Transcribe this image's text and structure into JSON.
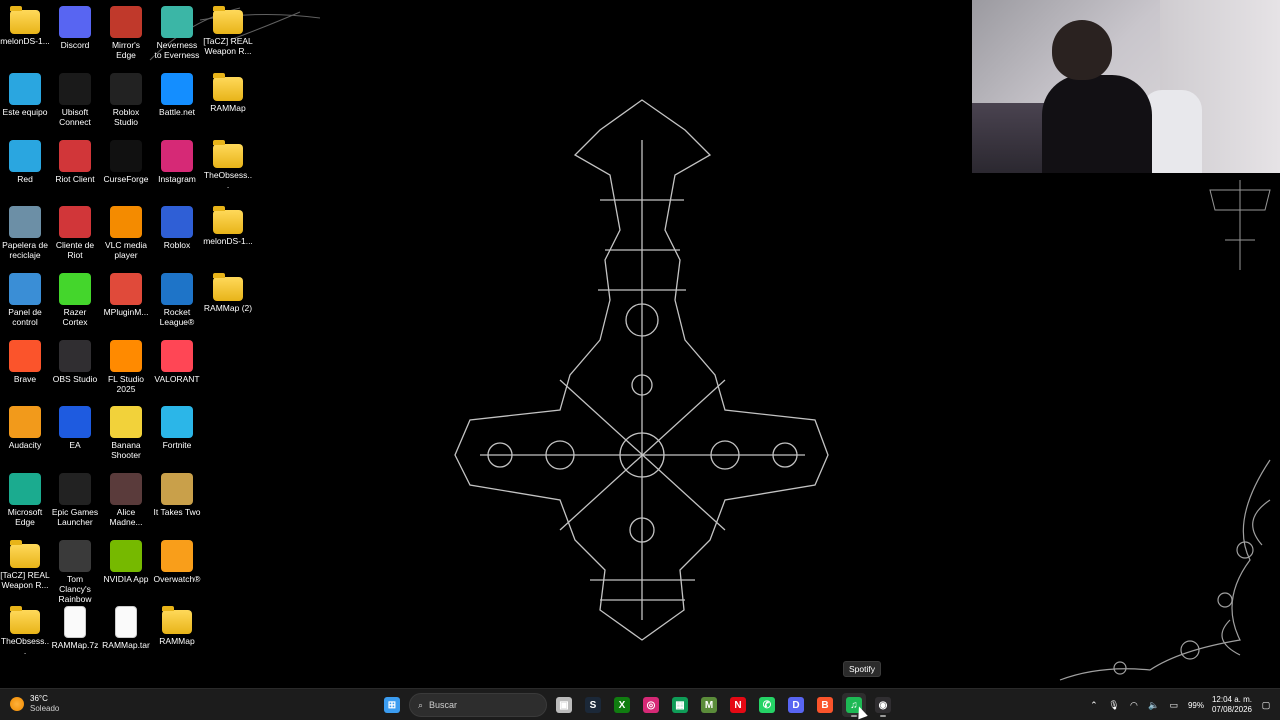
{
  "desktop": {
    "icons": [
      {
        "label": "melonDS-1...",
        "icon": "folder-icon",
        "color": "#f2c230"
      },
      {
        "label": "Discord",
        "icon": "discord-icon",
        "color": "#5865f2"
      },
      {
        "label": "Mirror's Edge",
        "icon": "mirrors-edge-icon",
        "color": "#c0392b"
      },
      {
        "label": "Neverness to Everness",
        "icon": "neverness-icon",
        "color": "#3bb6a6"
      },
      {
        "label": "[TaCZ] REAL Weapon R...",
        "icon": "folder-icon",
        "color": "#f2c230"
      },
      {
        "label": "Este equipo",
        "icon": "this-pc-icon",
        "color": "#2aa6e0"
      },
      {
        "label": "Ubisoft Connect",
        "icon": "ubisoft-icon",
        "color": "#1a1a1a"
      },
      {
        "label": "Roblox Studio",
        "icon": "roblox-studio-icon",
        "color": "#222"
      },
      {
        "label": "Battle.net",
        "icon": "battlenet-icon",
        "color": "#148eff"
      },
      {
        "label": "RAMMap",
        "icon": "folder-icon",
        "color": "#f2c230"
      },
      {
        "label": "Red",
        "icon": "network-icon",
        "color": "#2aa6e0"
      },
      {
        "label": "Riot Client",
        "icon": "riot-icon",
        "color": "#d13639"
      },
      {
        "label": "CurseForge",
        "icon": "curseforge-icon",
        "color": "#111"
      },
      {
        "label": "Instagram",
        "icon": "instagram-icon",
        "color": "#d62976"
      },
      {
        "label": "TheObsess...",
        "icon": "folder-icon",
        "color": "#f2c230"
      },
      {
        "label": "Papelera de reciclaje",
        "icon": "recycle-bin-icon",
        "color": "#6c8fa6"
      },
      {
        "label": "Cliente de Riot",
        "icon": "riot-icon",
        "color": "#d13639"
      },
      {
        "label": "VLC media player",
        "icon": "vlc-icon",
        "color": "#f48b00"
      },
      {
        "label": "Roblox",
        "icon": "roblox-icon",
        "color": "#2f5fd6"
      },
      {
        "label": "melonDS-1...",
        "icon": "folder-icon",
        "color": "#f2c230"
      },
      {
        "label": "Panel de control",
        "icon": "control-panel-icon",
        "color": "#3a8ed6"
      },
      {
        "label": "Razer Cortex",
        "icon": "razer-cortex-icon",
        "color": "#44d62c"
      },
      {
        "label": "MPluginM...",
        "icon": "mplugin-icon",
        "color": "#e04a3a"
      },
      {
        "label": "Rocket League®",
        "icon": "rocket-league-icon",
        "color": "#1e74c8"
      },
      {
        "label": "RAMMap (2)",
        "icon": "folder-icon",
        "color": "#f2c230"
      },
      {
        "label": "Brave",
        "icon": "brave-icon",
        "color": "#fb542b"
      },
      {
        "label": "OBS Studio",
        "icon": "obs-icon",
        "color": "#302e31"
      },
      {
        "label": "FL Studio 2025",
        "icon": "fl-studio-icon",
        "color": "#ff8a00"
      },
      {
        "label": "VALORANT",
        "icon": "valorant-icon",
        "color": "#ff4655"
      },
      {
        "label": "",
        "icon": "",
        "color": ""
      },
      {
        "label": "Audacity",
        "icon": "audacity-icon",
        "color": "#f29a1b"
      },
      {
        "label": "EA",
        "icon": "ea-icon",
        "color": "#1e5be0"
      },
      {
        "label": "Banana Shooter",
        "icon": "banana-shooter-icon",
        "color": "#f2d23a"
      },
      {
        "label": "Fortnite",
        "icon": "fortnite-icon",
        "color": "#2bb6e8"
      },
      {
        "label": "",
        "icon": "",
        "color": ""
      },
      {
        "label": "Microsoft Edge",
        "icon": "edge-icon",
        "color": "#1bab8f"
      },
      {
        "label": "Epic Games Launcher",
        "icon": "epic-games-icon",
        "color": "#222"
      },
      {
        "label": "Alice Madne...",
        "icon": "alice-madness-icon",
        "color": "#5a3b3b"
      },
      {
        "label": "It Takes Two",
        "icon": "it-takes-two-icon",
        "color": "#c9a04a"
      },
      {
        "label": "",
        "icon": "",
        "color": ""
      },
      {
        "label": "[TaCZ] REAL Weapon R...",
        "icon": "folder-icon",
        "color": "#f2c230"
      },
      {
        "label": "Tom Clancy's Rainbow Si...",
        "icon": "rainbow-six-icon",
        "color": "#3a3a3a"
      },
      {
        "label": "NVIDIA App",
        "icon": "nvidia-icon",
        "color": "#76b900"
      },
      {
        "label": "Overwatch®",
        "icon": "overwatch-icon",
        "color": "#f99e1a"
      },
      {
        "label": "",
        "icon": "",
        "color": ""
      },
      {
        "label": "TheObsess...",
        "icon": "folder-icon",
        "color": "#f2c230"
      },
      {
        "label": "RAMMap.7z",
        "icon": "file-icon",
        "color": "#fafafa"
      },
      {
        "label": "RAMMap.tar",
        "icon": "file-icon",
        "color": "#fafafa"
      },
      {
        "label": "RAMMap",
        "icon": "folder-icon",
        "color": "#f2c230"
      },
      {
        "label": "",
        "icon": "",
        "color": ""
      }
    ]
  },
  "tooltip": {
    "text": "Spotify"
  },
  "taskbar": {
    "weather": {
      "temp": "36°C",
      "condition": "Soleado"
    },
    "search_placeholder": "Buscar",
    "apps": [
      {
        "name": "start-button",
        "glyph": "⊞",
        "color": "#3b9cf0"
      },
      {
        "name": "task-view-button",
        "glyph": "▣",
        "color": "#bbbbbb"
      },
      {
        "name": "steam-button",
        "glyph": "S",
        "color": "#1b2838"
      },
      {
        "name": "xbox-button",
        "glyph": "X",
        "color": "#107c10"
      },
      {
        "name": "instagram-button",
        "glyph": "◎",
        "color": "#d62976"
      },
      {
        "name": "xbox-app-button",
        "glyph": "▦",
        "color": "#0f9d58"
      },
      {
        "name": "minecraft-button",
        "glyph": "M",
        "color": "#5b8c3a"
      },
      {
        "name": "netflix-button",
        "glyph": "N",
        "color": "#e50914"
      },
      {
        "name": "whatsapp-button",
        "glyph": "✆",
        "color": "#25d366"
      },
      {
        "name": "discord-button",
        "glyph": "D",
        "color": "#5865f2"
      },
      {
        "name": "brave-button",
        "glyph": "B",
        "color": "#fb542b"
      },
      {
        "name": "spotify-button",
        "glyph": "♫",
        "color": "#1db954"
      },
      {
        "name": "obs-button",
        "glyph": "◉",
        "color": "#302e31"
      }
    ],
    "tray": {
      "battery": "99%",
      "time": "12:04 a. m.",
      "date": "07/08/2026"
    }
  }
}
